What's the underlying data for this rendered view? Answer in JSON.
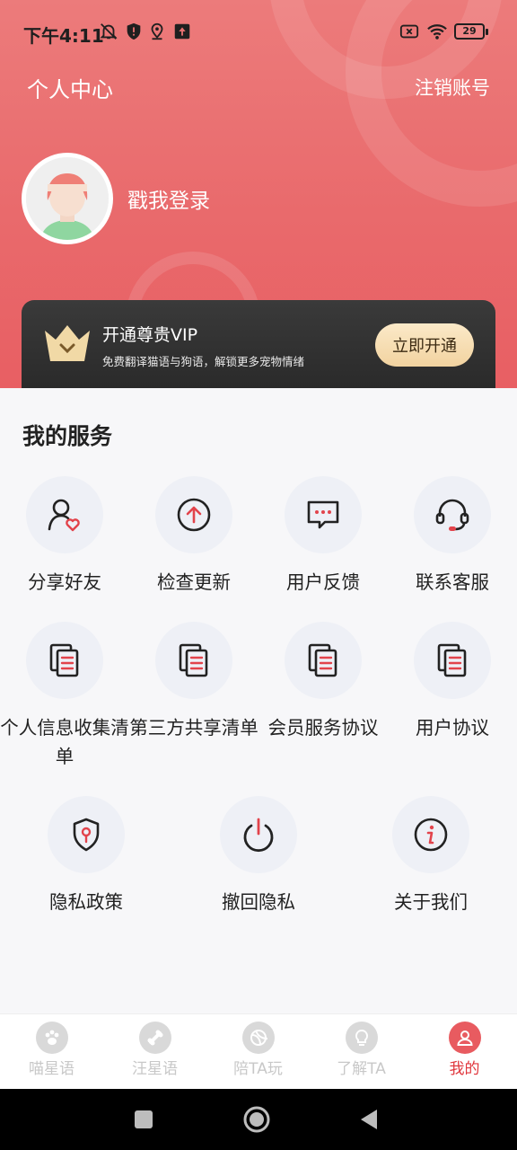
{
  "status_bar": {
    "time": "下午4:11",
    "battery": "29"
  },
  "header": {
    "title": "个人中心",
    "logout_label": "注销账号",
    "login_text": "戳我登录"
  },
  "vip": {
    "title": "开通尊贵VIP",
    "subtitle": "免费翻译猫语与狗语，解锁更多宠物情绪",
    "button_label": "立即开通"
  },
  "services": {
    "title": "我的服务",
    "items": [
      {
        "label": "分享好友",
        "icon": "share-friend-icon"
      },
      {
        "label": "检查更新",
        "icon": "upload-arrow-icon"
      },
      {
        "label": "用户反馈",
        "icon": "message-icon"
      },
      {
        "label": "联系客服",
        "icon": "headset-icon"
      },
      {
        "label": "个人信息收集清单",
        "icon": "document-icon"
      },
      {
        "label": "第三方共享清单",
        "icon": "document-icon"
      },
      {
        "label": "会员服务协议",
        "icon": "document-icon"
      },
      {
        "label": "用户协议",
        "icon": "document-icon"
      },
      {
        "label": "隐私政策",
        "icon": "shield-icon"
      },
      {
        "label": "撤回隐私",
        "icon": "power-icon"
      },
      {
        "label": "关于我们",
        "icon": "info-icon"
      }
    ]
  },
  "tabbar": {
    "items": [
      {
        "label": "喵星语",
        "icon": "paw-icon"
      },
      {
        "label": "汪星语",
        "icon": "bone-icon"
      },
      {
        "label": "陪TA玩",
        "icon": "ball-icon"
      },
      {
        "label": "了解TA",
        "icon": "bulb-icon"
      },
      {
        "label": "我的",
        "icon": "user-icon",
        "active": true
      }
    ]
  },
  "colors": {
    "accent": "#e85b60",
    "header_top": "#ec7b7b",
    "vip_bg": "#2f2f2f"
  }
}
